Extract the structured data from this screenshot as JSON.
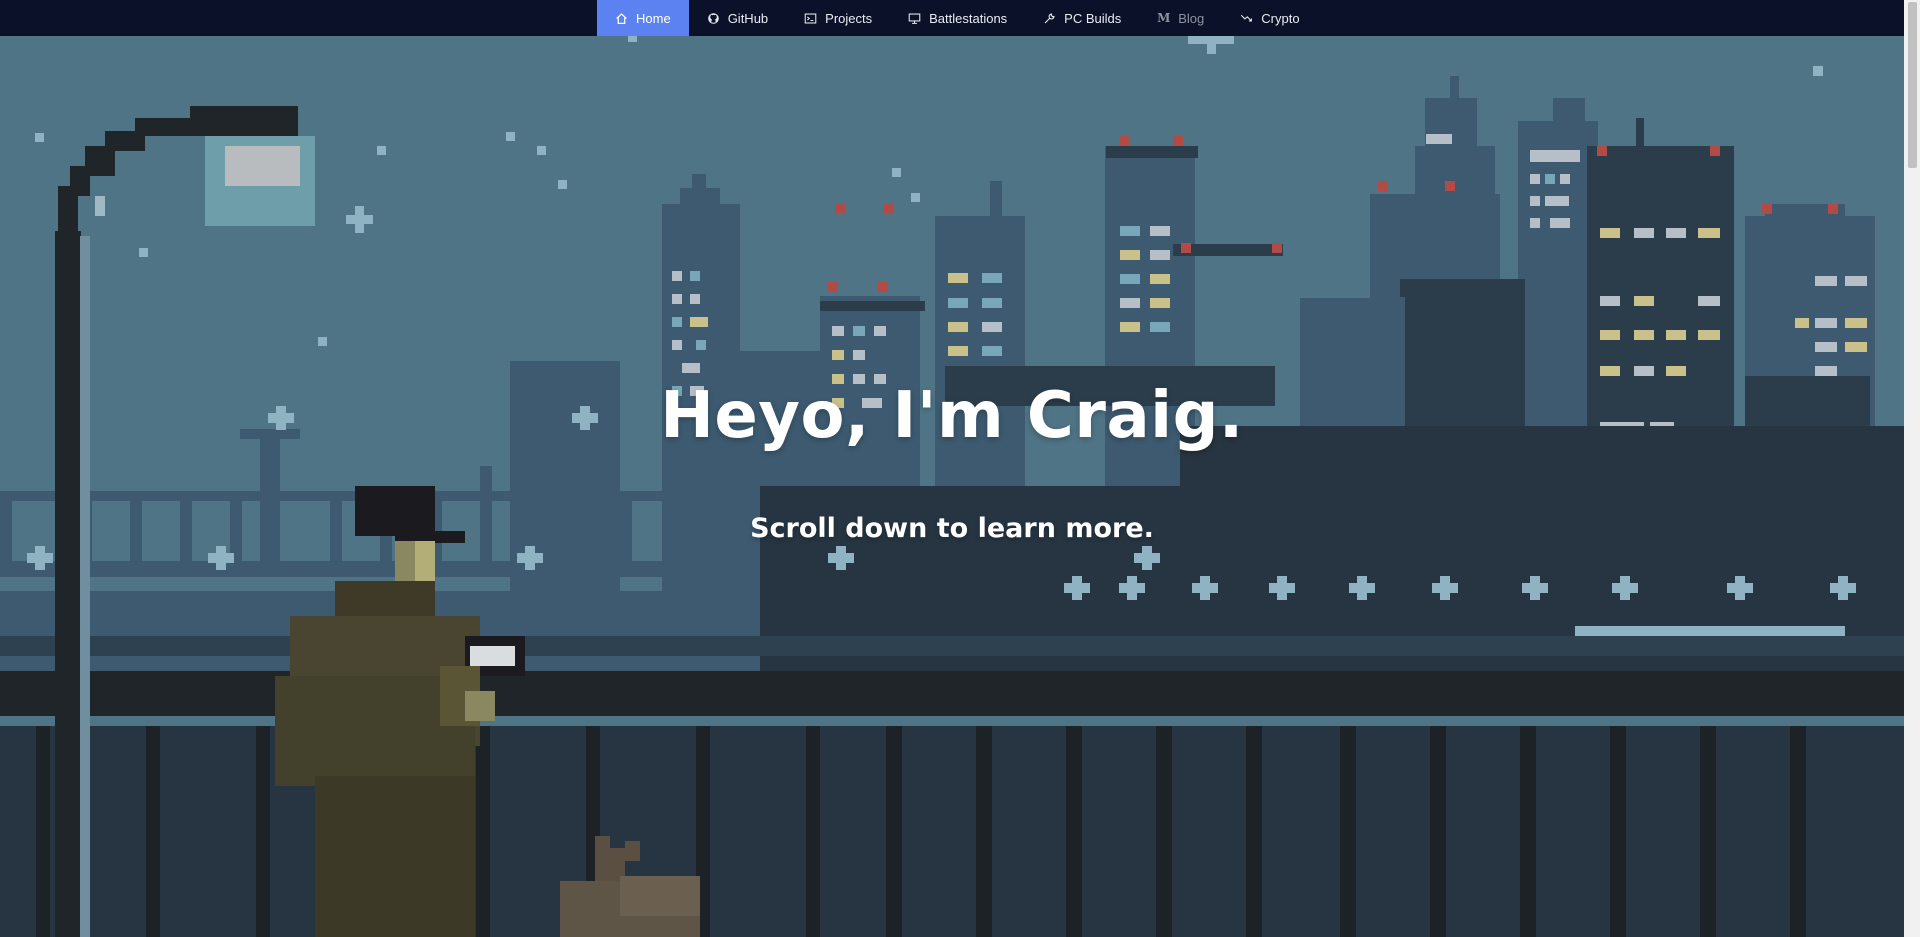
{
  "nav": {
    "items": [
      {
        "label": "Home",
        "icon": "home-icon",
        "active": true
      },
      {
        "label": "GitHub",
        "icon": "github-icon"
      },
      {
        "label": "Projects",
        "icon": "terminal-icon"
      },
      {
        "label": "Battlestations",
        "icon": "monitor-icon"
      },
      {
        "label": "PC Builds",
        "icon": "wrench-icon"
      },
      {
        "label": "Blog",
        "icon": "medium-icon"
      },
      {
        "label": "Crypto",
        "icon": "chart-down-icon"
      }
    ]
  },
  "hero": {
    "title": "Heyo, I'm Craig.",
    "subtitle": "Scroll down to learn more."
  },
  "colors": {
    "nav_bg": "#0a1128",
    "nav_active": "#5b82f0",
    "sky": "#4d7285",
    "building_dark": "#263541",
    "railing": "#1f2528"
  }
}
